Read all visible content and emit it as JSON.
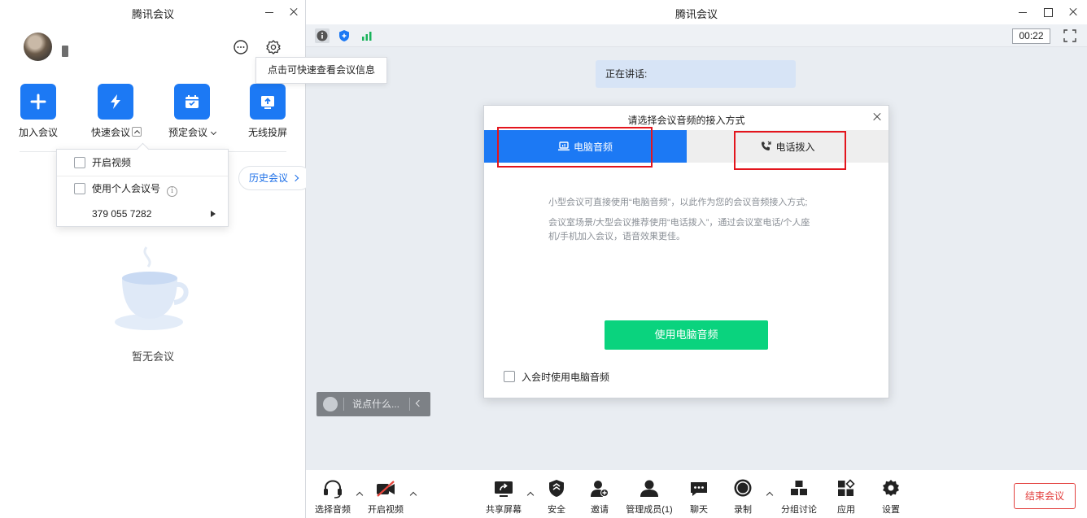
{
  "left_window": {
    "title": "腾讯会议",
    "tooltip": "点击可快速查看会议信息",
    "actions": [
      {
        "label": "加入会议",
        "icon": "plus-icon"
      },
      {
        "label": "快速会议",
        "icon": "lightning-icon"
      },
      {
        "label": "预定会议",
        "icon": "calendar-icon"
      },
      {
        "label": "无线投屏",
        "icon": "screen-cast-icon"
      }
    ],
    "quick_meeting_menu": {
      "enable_video": "开启视频",
      "use_personal_id": "使用个人会议号",
      "personal_id": "379 055 7282"
    },
    "history_button": "历史会议",
    "empty_text": "暂无会议"
  },
  "right_window": {
    "title": "腾讯会议",
    "timer": "00:22",
    "speaking_label": "正在讲话:",
    "dialog": {
      "title": "请选择会议音频的接入方式",
      "tab_computer": "电脑音频",
      "tab_phone": "电话拨入",
      "desc_line1": "小型会议可直接使用“电脑音频”，以此作为您的会议音频接入方式;",
      "desc_line2": "会议室场景/大型会议推荐使用“电话拨入”，通过会议室电话/个人座",
      "desc_line3": "机/手机加入会议，语音效果更佳。",
      "use_button": "使用电脑音频",
      "checkbox_label": "入会时使用电脑音频"
    },
    "chat_placeholder": "说点什么...",
    "toolbar": [
      {
        "label": "选择音频",
        "icon": "headset-icon"
      },
      {
        "label": "开启视频",
        "icon": "video-off-icon"
      },
      {
        "label": "共享屏幕",
        "icon": "share-screen-icon"
      },
      {
        "label": "安全",
        "icon": "shield-icon"
      },
      {
        "label": "邀请",
        "icon": "invite-icon"
      },
      {
        "label": "管理成员(1)",
        "icon": "members-icon"
      },
      {
        "label": "聊天",
        "icon": "chat-icon"
      },
      {
        "label": "录制",
        "icon": "record-icon"
      },
      {
        "label": "分组讨论",
        "icon": "breakout-icon"
      },
      {
        "label": "应用",
        "icon": "apps-icon"
      },
      {
        "label": "设置",
        "icon": "gear-icon"
      }
    ],
    "end_button": "结束会议"
  },
  "colors": {
    "accent": "#1c79f4",
    "green": "#0ad37e",
    "highlight_red": "#e3151d"
  }
}
